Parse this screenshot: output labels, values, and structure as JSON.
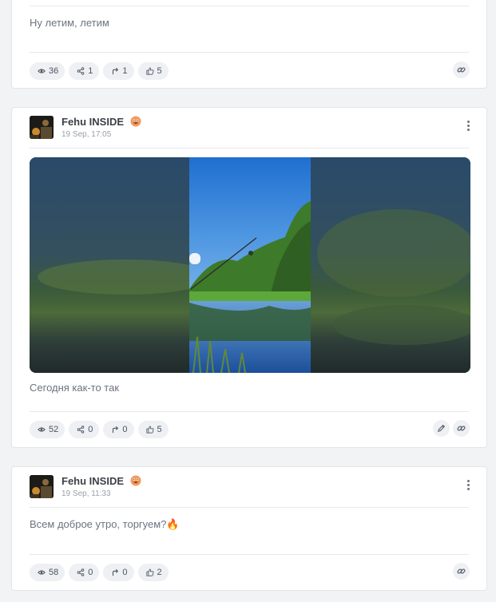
{
  "posts": [
    {
      "text": "Ну летим, летим",
      "stats": {
        "views": "36",
        "shares": "1",
        "forwards": "1",
        "likes": "5"
      }
    },
    {
      "author": "Fehu INSIDE",
      "date": "19 Sep, 17:05",
      "text": "Сегодня как-то так",
      "stats": {
        "views": "52",
        "shares": "0",
        "forwards": "0",
        "likes": "5"
      }
    },
    {
      "author": "Fehu INSIDE",
      "date": "19 Sep, 11:33",
      "text": "Всем доброе утро, торгуем?🔥",
      "stats": {
        "views": "58",
        "shares": "0",
        "forwards": "0",
        "likes": "2"
      }
    }
  ],
  "icons": {
    "views": "eye-icon",
    "shares": "share-icon",
    "forwards": "forward-icon",
    "likes": "thumbs-up-icon",
    "link": "link-icon",
    "edit": "pencil-icon",
    "menu": "kebab-menu-icon"
  },
  "colors": {
    "page_bg": "#f1f3f5",
    "card_bg": "#ffffff",
    "pill_bg": "#eef0f3",
    "text_muted": "#6c7380",
    "author": "#3b3f46"
  }
}
